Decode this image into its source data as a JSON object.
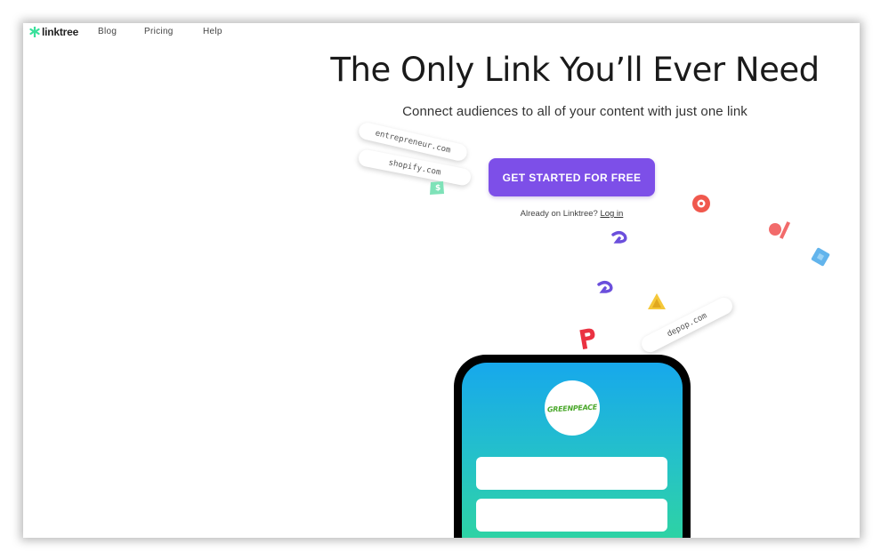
{
  "nav": {
    "brand": "linktree",
    "links": [
      "Blog",
      "Pricing",
      "Help"
    ]
  },
  "hero": {
    "headline": "The Only Link You’ll Ever Need",
    "subhead": "Connect audiences to all of your content with just one link",
    "cta_label": "GET STARTED FOR FREE",
    "already_text": "Already on Linktree?",
    "login_label": "Log in"
  },
  "floating_links": [
    "entrepreneur.com",
    "shopify.com",
    "depop.com"
  ],
  "phone": {
    "profile_logo_text": "GREENPEACE"
  },
  "icons": {
    "brand": "linktree-logo-icon",
    "floating": [
      "shopify-bag-icon",
      "patreon-icon",
      "bandsintown-icon",
      "patreon-p-icon",
      "ko-fi-arrow-icon",
      "ko-fi-arrow-icon",
      "triangle-icon",
      "tag-icon"
    ]
  },
  "colors": {
    "accent": "#7d4fe8",
    "brand_green": "#39e09b",
    "phone_gradient_top": "#17a8ec",
    "phone_gradient_bottom": "#30d79a"
  }
}
